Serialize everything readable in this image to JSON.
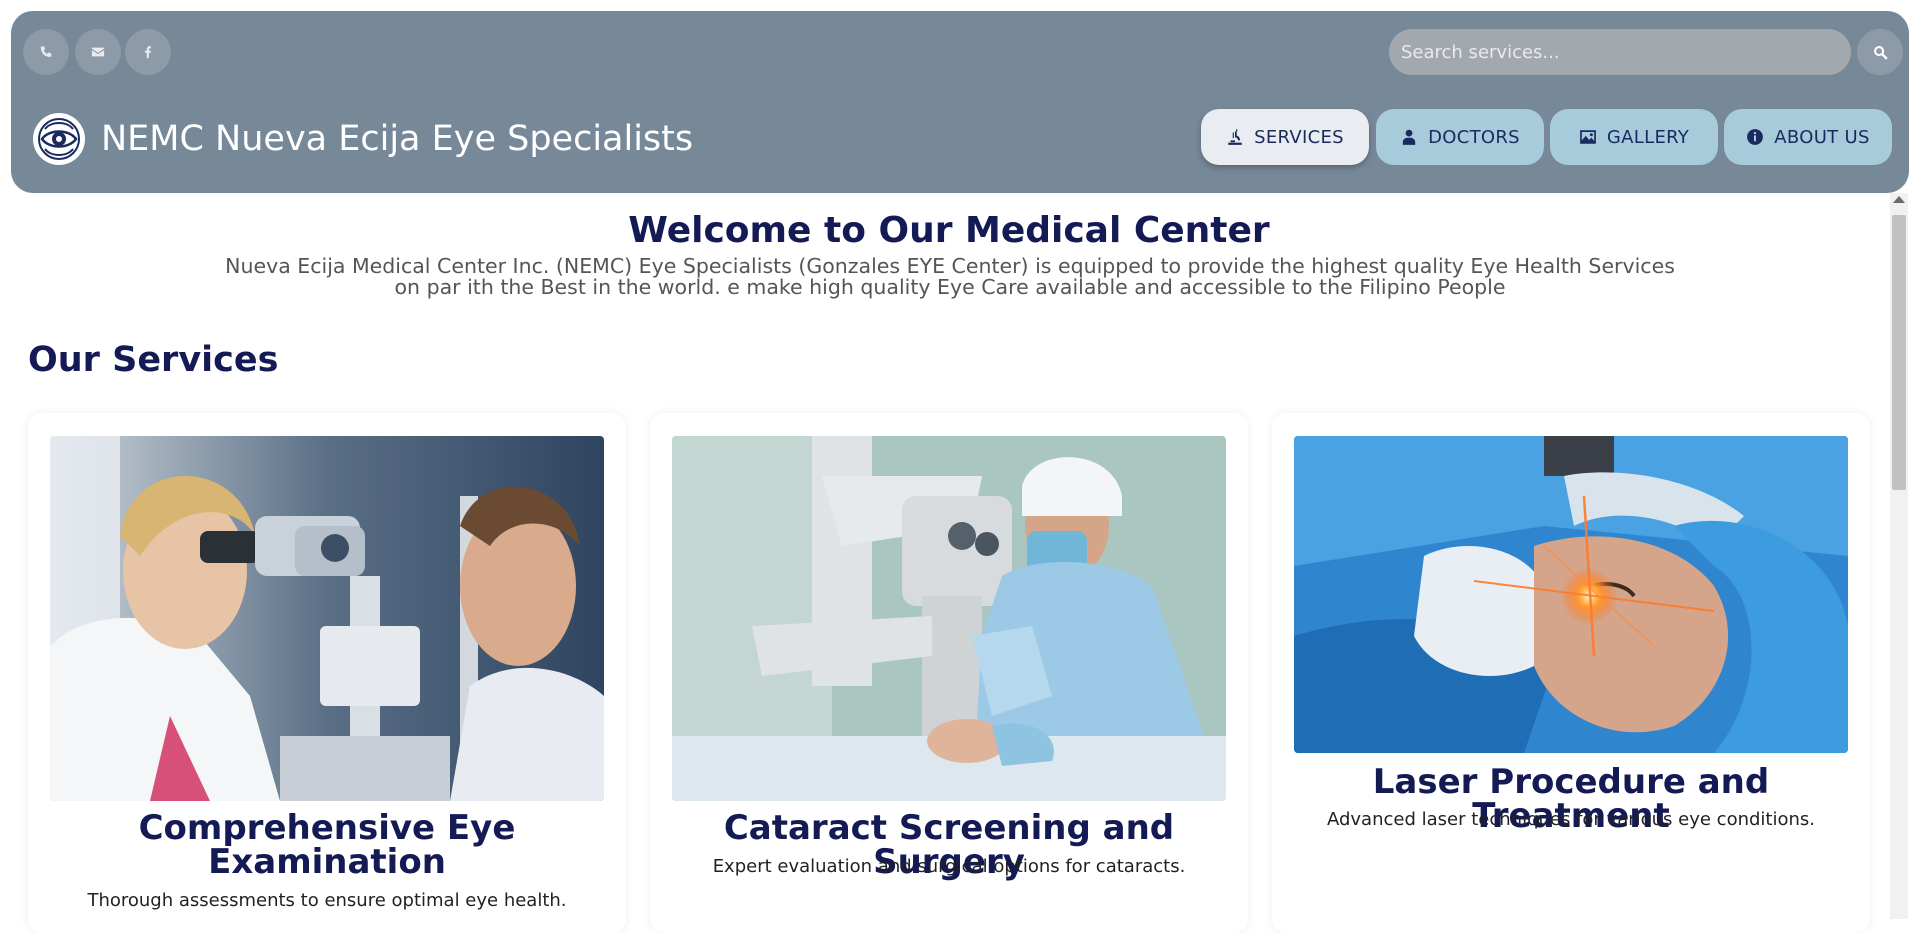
{
  "header": {
    "brand": "NEMC Nueva Ecija Eye Specialists",
    "contact_icons": [
      "phone-icon",
      "envelope-icon",
      "facebook-icon"
    ],
    "search": {
      "placeholder": "Search services..."
    },
    "nav": [
      {
        "label": "SERVICES",
        "icon": "microscope-icon",
        "active": true
      },
      {
        "label": "DOCTORS",
        "icon": "doctor-icon",
        "active": false
      },
      {
        "label": "GALLERY",
        "icon": "image-icon",
        "active": false
      },
      {
        "label": "ABOUT US",
        "icon": "info-icon",
        "active": false
      }
    ]
  },
  "welcome": {
    "title": "Welcome to Our Medical Center",
    "text": "Nueva Ecija Medical Center Inc. (NEMC) Eye Specialists (Gonzales EYE Center) is equipped to provide the highest quality Eye Health Services on par ith the Best in the world. e make high quality Eye Care available and accessible to the Filipino People"
  },
  "services": {
    "title": "Our Services",
    "items": [
      {
        "title": "Comprehensive Eye Examination",
        "description": "Thorough assessments to ensure optimal eye health.",
        "image": "eye-exam-photo"
      },
      {
        "title": "Cataract Screening and Surgery",
        "description": "Expert evaluation and surgical options for cataracts.",
        "image": "cataract-surgery-photo"
      },
      {
        "title": "Laser Procedure and Treatment",
        "description": "Advanced laser techniques for various eye conditions.",
        "image": "laser-procedure-photo"
      }
    ]
  },
  "colors": {
    "header_bg": "#778899",
    "nav_button": "#a7cbdb",
    "nav_active": "#e9ecf0",
    "heading": "#141a54"
  }
}
